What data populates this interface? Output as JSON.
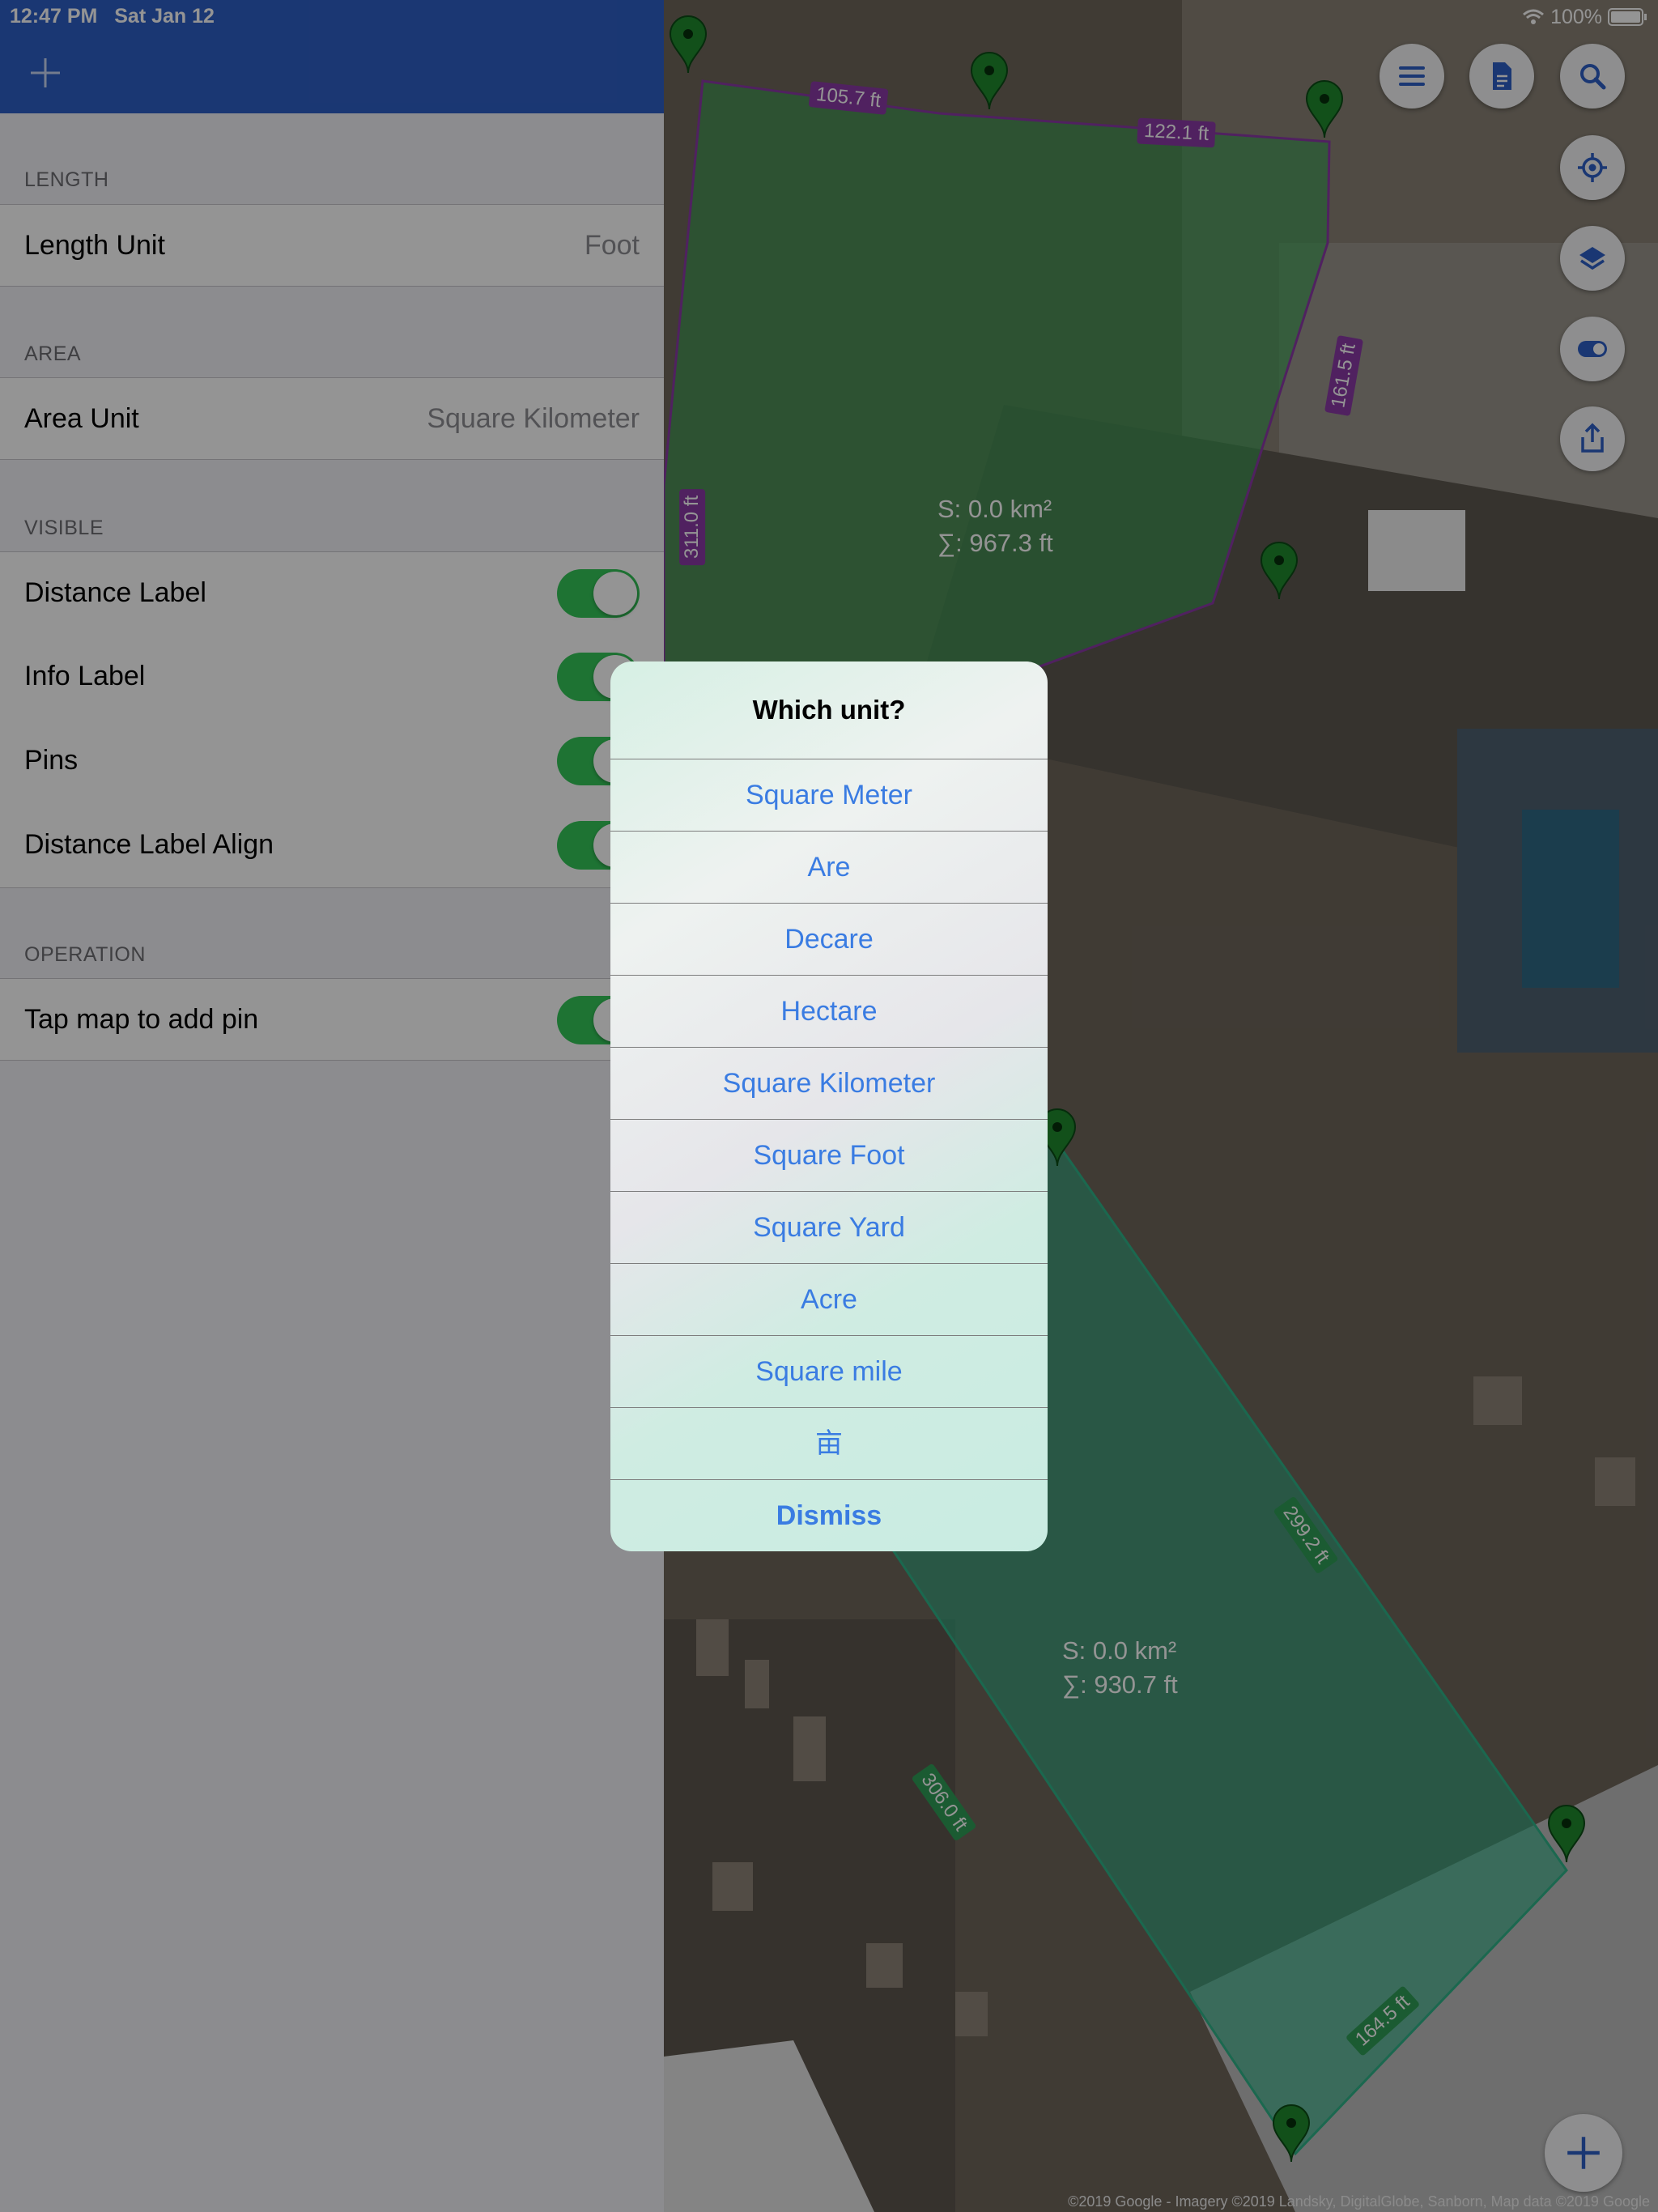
{
  "status_bar": {
    "time": "12:47 PM",
    "date": "Sat Jan 12",
    "battery": "100%"
  },
  "nav": {
    "add_icon": "plus-icon"
  },
  "settings": {
    "length": {
      "header": "LENGTH",
      "unit_label": "Length Unit",
      "unit_value": "Foot"
    },
    "area": {
      "header": "AREA",
      "unit_label": "Area Unit",
      "unit_value": "Square Kilometer"
    },
    "visible": {
      "header": "VISIBLE",
      "items": [
        {
          "label": "Distance Label",
          "on": true
        },
        {
          "label": "Info Label",
          "on": true
        },
        {
          "label": "Pins",
          "on": true
        },
        {
          "label": "Distance Label Align",
          "on": true
        }
      ]
    },
    "operation": {
      "header": "OPERATION",
      "items": [
        {
          "label": "Tap map to add pin",
          "on": true
        }
      ]
    }
  },
  "map": {
    "buttons": [
      "list-icon",
      "document-icon",
      "search-icon",
      "locate-icon",
      "layers-icon",
      "toggle-icon",
      "share-icon",
      "plus-icon"
    ],
    "distance_labels_top": [
      "105.7 ft",
      "122.1 ft",
      "161.5 ft",
      "311.0 ft"
    ],
    "distance_labels_bottom": [
      "299.2 ft",
      "306.0 ft",
      "164.5 ft"
    ],
    "info_top": "S: 0.0 km²\n∑: 967.3 ft",
    "info_bottom": "S: 0.0 km²\n∑: 930.7 ft",
    "attribution": "©2019 Google - Imagery ©2019 Landsky, DigitalGlobe, Sanborn, Map data ©2019 Google",
    "polygon_top_color": "#3aa655",
    "polygon_bottom_color": "#2fb489"
  },
  "alert": {
    "title": "Which unit?",
    "options": [
      "Square Meter",
      "Are",
      "Decare",
      "Hectare",
      "Square Kilometer",
      "Square Foot",
      "Square Yard",
      "Acre",
      "Square mile",
      "亩"
    ],
    "dismiss": "Dismiss"
  }
}
